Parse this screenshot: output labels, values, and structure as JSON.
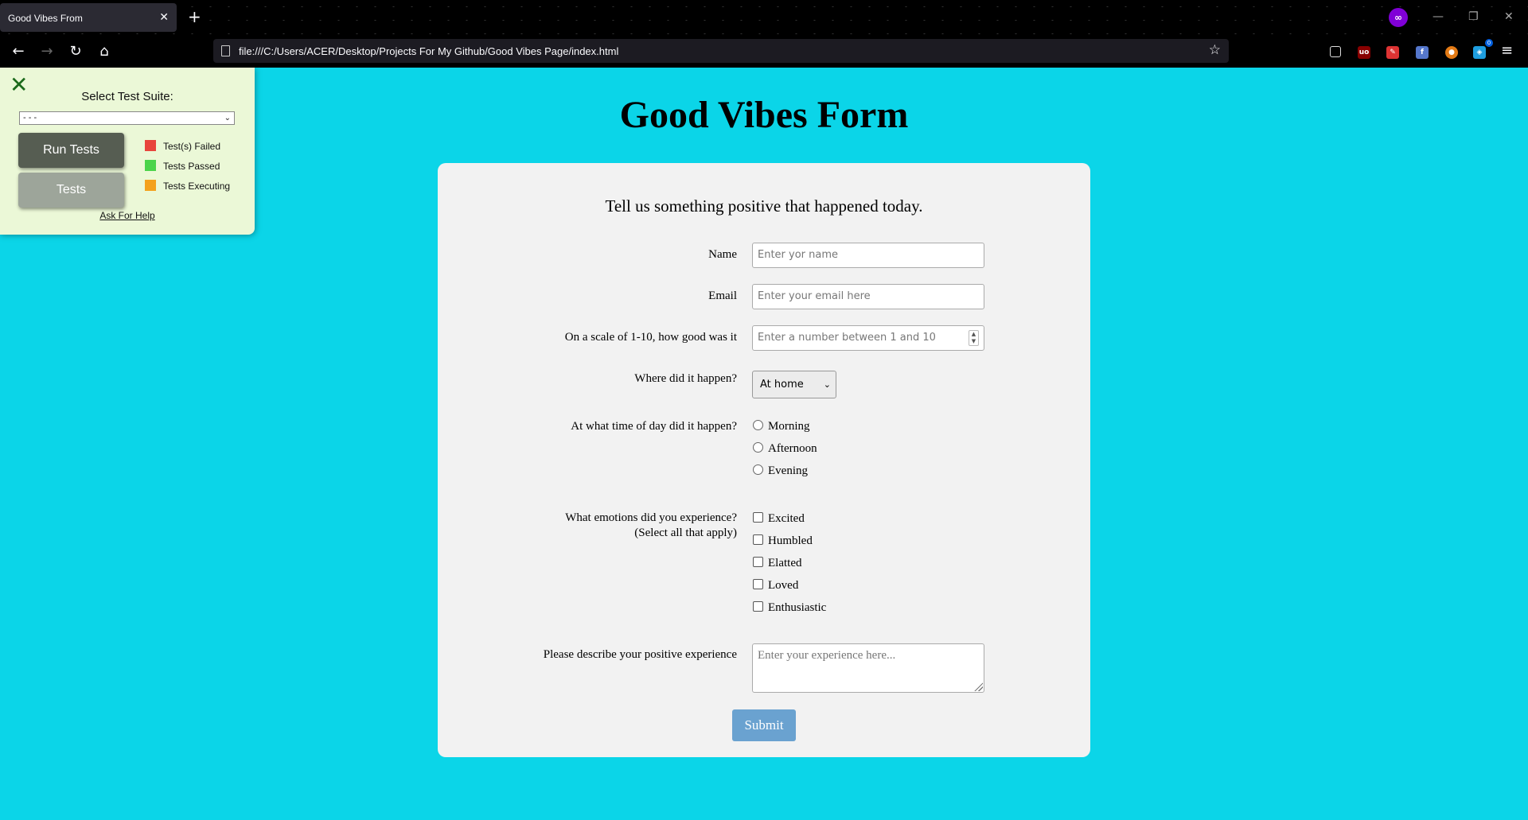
{
  "browser": {
    "tab_title": "Good Vibes From",
    "tab_close": "✕",
    "new_tab": "+",
    "url": "file:///C:/Users/ACER/Desktop/Projects For My Github/Good Vibes Page/index.html",
    "extension_badge": "0"
  },
  "test_panel": {
    "suite_label": "Select Test Suite:",
    "suite_selected": "- - -",
    "run_button": "Run Tests",
    "tests_button": "Tests",
    "legend": [
      {
        "label": "Test(s) Failed",
        "color": "#e8453c"
      },
      {
        "label": "Tests Passed",
        "color": "#4bd44b"
      },
      {
        "label": "Tests Executing",
        "color": "#f4a11c"
      }
    ],
    "help_link": "Ask For Help"
  },
  "page": {
    "title": "Good Vibes Form",
    "description": "Tell us something positive that happened today.",
    "fields": {
      "name_label": "Name",
      "name_placeholder": "Enter yor name",
      "email_label": "Email",
      "email_placeholder": "Enter your email here",
      "scale_label": "On a scale of 1-10, how good was it",
      "scale_placeholder": "Enter a number between 1 and 10",
      "where_label": "Where did it happen?",
      "where_selected": "At home",
      "time_label": "At what time of day did it happen?",
      "time_options": [
        "Morning",
        "Afternoon",
        "Evening"
      ],
      "emotions_label_line1": "What emotions did you experience?",
      "emotions_label_line2": "(Select all that apply)",
      "emotion_options": [
        "Excited",
        "Humbled",
        "Elatted",
        "Loved",
        "Enthusiastic"
      ],
      "describe_label": "Please describe your positive experience",
      "describe_placeholder": "Enter your experience here..."
    },
    "submit_label": "Submit"
  },
  "colors": {
    "page_background": "#0bd5e8",
    "card_background": "#f2f2f2",
    "submit_button": "#6aa2d0",
    "panel_background": "#ebf8d7"
  }
}
